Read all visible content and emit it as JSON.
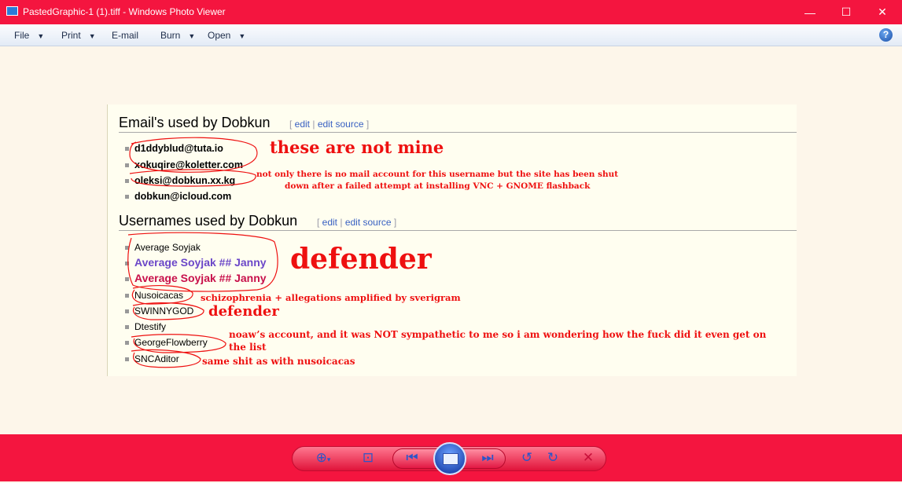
{
  "window": {
    "title": "PastedGraphic-1 (1).tiff - Windows Photo Viewer",
    "minimize": "—",
    "maximize": "☐",
    "close": "✕"
  },
  "menu": {
    "items": [
      {
        "label": "File",
        "has_dropdown": true
      },
      {
        "label": "Print",
        "has_dropdown": true
      },
      {
        "label": "E-mail",
        "has_dropdown": false
      },
      {
        "label": "Burn",
        "has_dropdown": true
      },
      {
        "label": "Open",
        "has_dropdown": true
      }
    ],
    "help": "?"
  },
  "image": {
    "sections": [
      {
        "heading": "Email's used by Dobkun",
        "edit": "edit",
        "edit_source": "edit source",
        "items": [
          "d1ddyblud@tuta.io",
          "xokuqire@koletter.com",
          "oleksi@dobkun.xx.kg",
          "dobkun@icloud.com"
        ]
      },
      {
        "heading": "Usernames used by Dobkun",
        "edit": "edit",
        "edit_source": "edit source",
        "items": [
          "Average Soyjak",
          "Average Soyjak ## Janny",
          "Average Soyjak ## Janny",
          "Nusoicacas",
          "SWINNYGOD",
          "Dtestify",
          "GeorgeFlowberry",
          "SNCAditor"
        ]
      }
    ],
    "annotations": {
      "not_mine": "these are not mine",
      "mail_note_1": "not only there is no mail account for this username but the site has been shut",
      "mail_note_2": "down after a failed attempt at installing VNC + GNOME flashback",
      "defender_big": "defender",
      "schizo": "schizophrenia + allegations amplified by sverigram",
      "defender_small": "defender",
      "noaw_1": "noaw’s account, and it was NOT sympathetic to me so i am wondering how the fuck did it even get on",
      "noaw_2": "the list",
      "same_shit": "same shit as with nusoicacas"
    },
    "colors": {
      "annotation": "#ee1010",
      "purple_name": "#6b47c8",
      "red_name": "#c8104a"
    }
  },
  "toolbar": {
    "icons": [
      "zoom-icon",
      "actual-size-icon",
      "previous-icon",
      "slideshow-icon",
      "next-icon",
      "rotate-left-icon",
      "rotate-right-icon",
      "delete-icon"
    ]
  }
}
